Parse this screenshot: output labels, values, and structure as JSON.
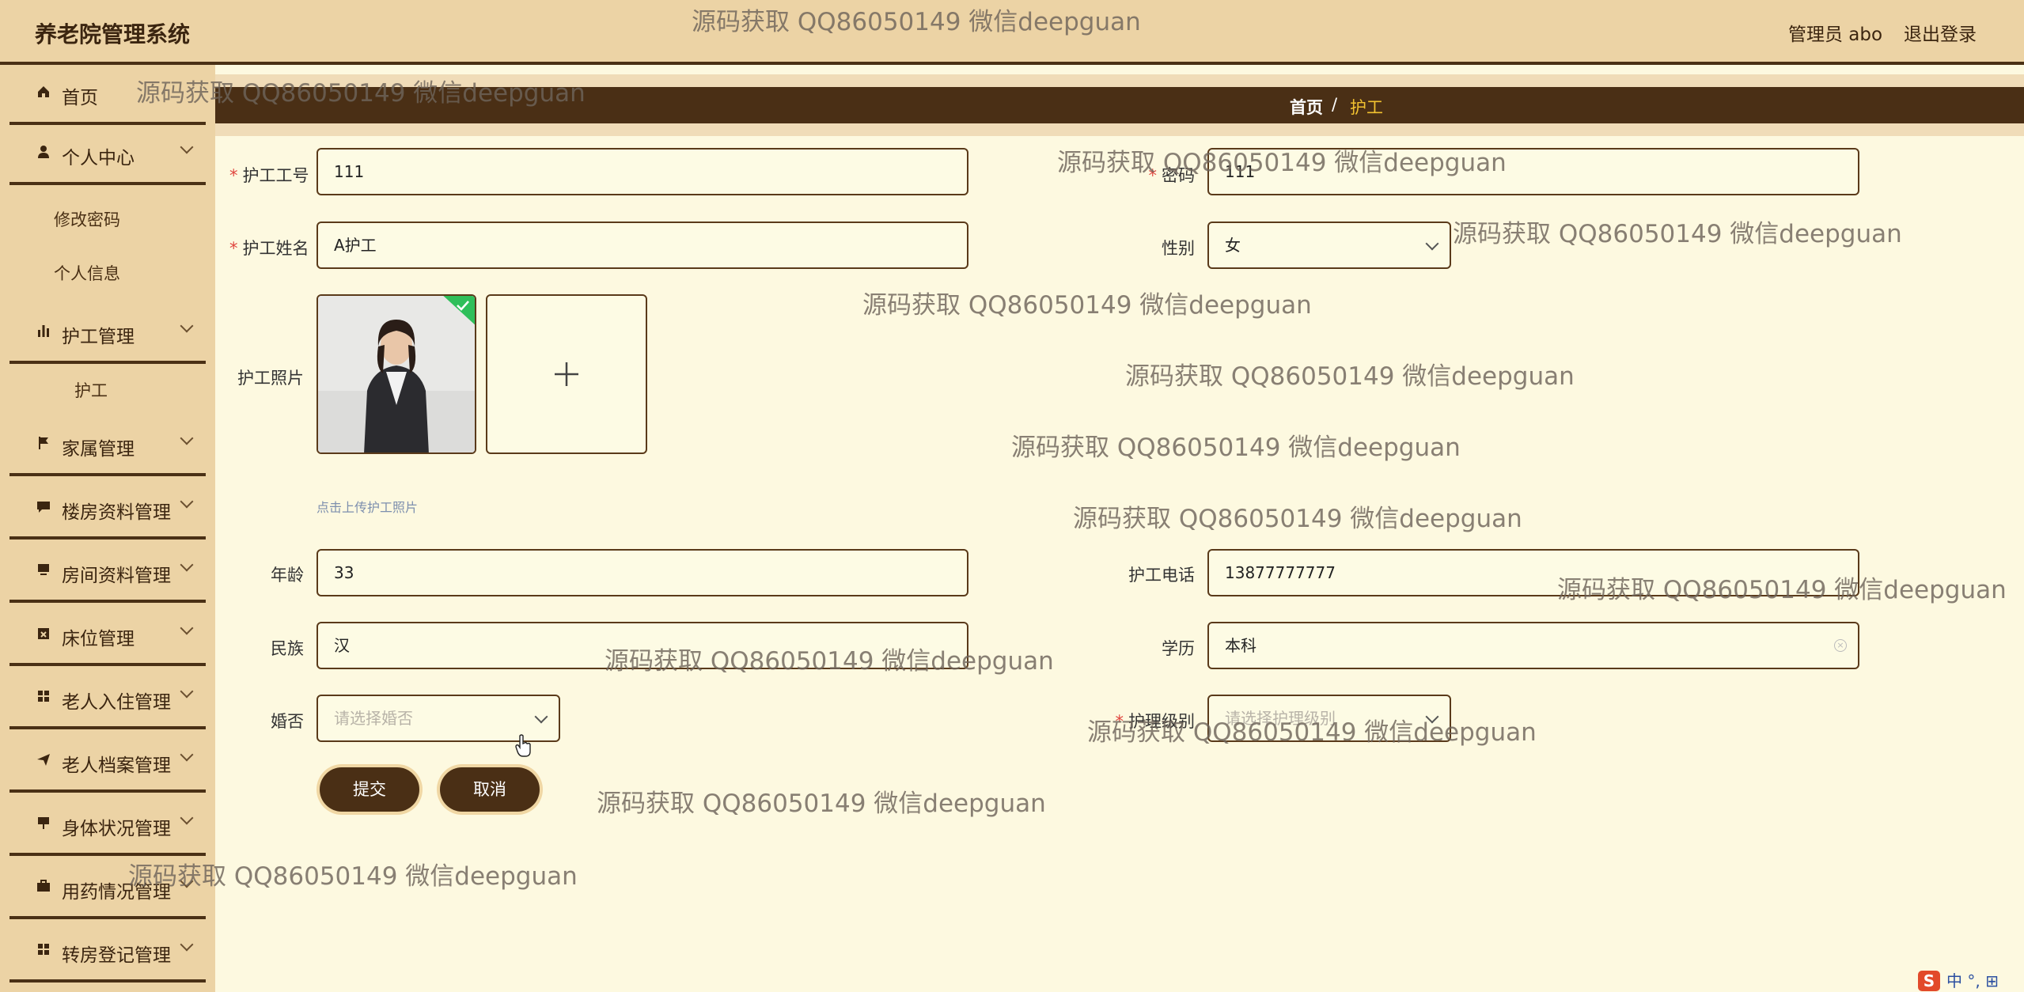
{
  "app": {
    "title": "养老院管理系统"
  },
  "topbar": {
    "admin_label": "管理员 abo",
    "logout_label": "退出登录"
  },
  "sidebar": {
    "items": [
      {
        "label": "首页",
        "icon": "home-icon"
      },
      {
        "label": "个人中心",
        "icon": "user-icon"
      },
      {
        "label": "护工管理",
        "icon": "bar-chart-icon"
      },
      {
        "label": "家属管理",
        "icon": "flag-icon"
      },
      {
        "label": "楼房资料管理",
        "icon": "chat-icon"
      },
      {
        "label": "房间资料管理",
        "icon": "monitor-icon"
      },
      {
        "label": "床位管理",
        "icon": "calendar-x-icon"
      },
      {
        "label": "老人入住管理",
        "icon": "grid-icon"
      },
      {
        "label": "老人档案管理",
        "icon": "send-icon"
      },
      {
        "label": "身体状况管理",
        "icon": "chalkboard-icon"
      },
      {
        "label": "用药情况管理",
        "icon": "briefcase-icon"
      },
      {
        "label": "转房登记管理",
        "icon": "grid-icon"
      }
    ],
    "sub_items": {
      "change_password": "修改密码",
      "personal_info": "个人信息",
      "nurse": "护工"
    }
  },
  "breadcrumb": {
    "home": "首页",
    "separator": "/",
    "current": "护工"
  },
  "form": {
    "nurse_id": {
      "label": "护工工号",
      "value": "111"
    },
    "password": {
      "label": "密码",
      "value": "111"
    },
    "nurse_name": {
      "label": "护工姓名",
      "value": "A护工"
    },
    "gender": {
      "label": "性别",
      "value": "女"
    },
    "photo": {
      "label": "护工照片",
      "upload_hint": "点击上传护工照片"
    },
    "age": {
      "label": "年龄",
      "value": "33"
    },
    "phone": {
      "label": "护工电话",
      "value": "13877777777"
    },
    "ethnicity": {
      "label": "民族",
      "value": "汉"
    },
    "education": {
      "label": "学历",
      "value": "本科"
    },
    "marital": {
      "label": "婚否",
      "placeholder": "请选择婚否"
    },
    "care_level": {
      "label": "护理级别",
      "placeholder": "请选择护理级别"
    },
    "submit_label": "提交",
    "cancel_label": "取消"
  },
  "watermark": "源码获取 QQ86050149 微信deepguan",
  "ime": {
    "logo": "S",
    "text": "中 °, ⊞"
  },
  "colors": {
    "topbar_bg": "#ecd3a5",
    "accent_dark": "#4a2f15",
    "page_bg": "#fdf9e0",
    "crumb_current": "#f2c230",
    "required": "#e0463f"
  }
}
